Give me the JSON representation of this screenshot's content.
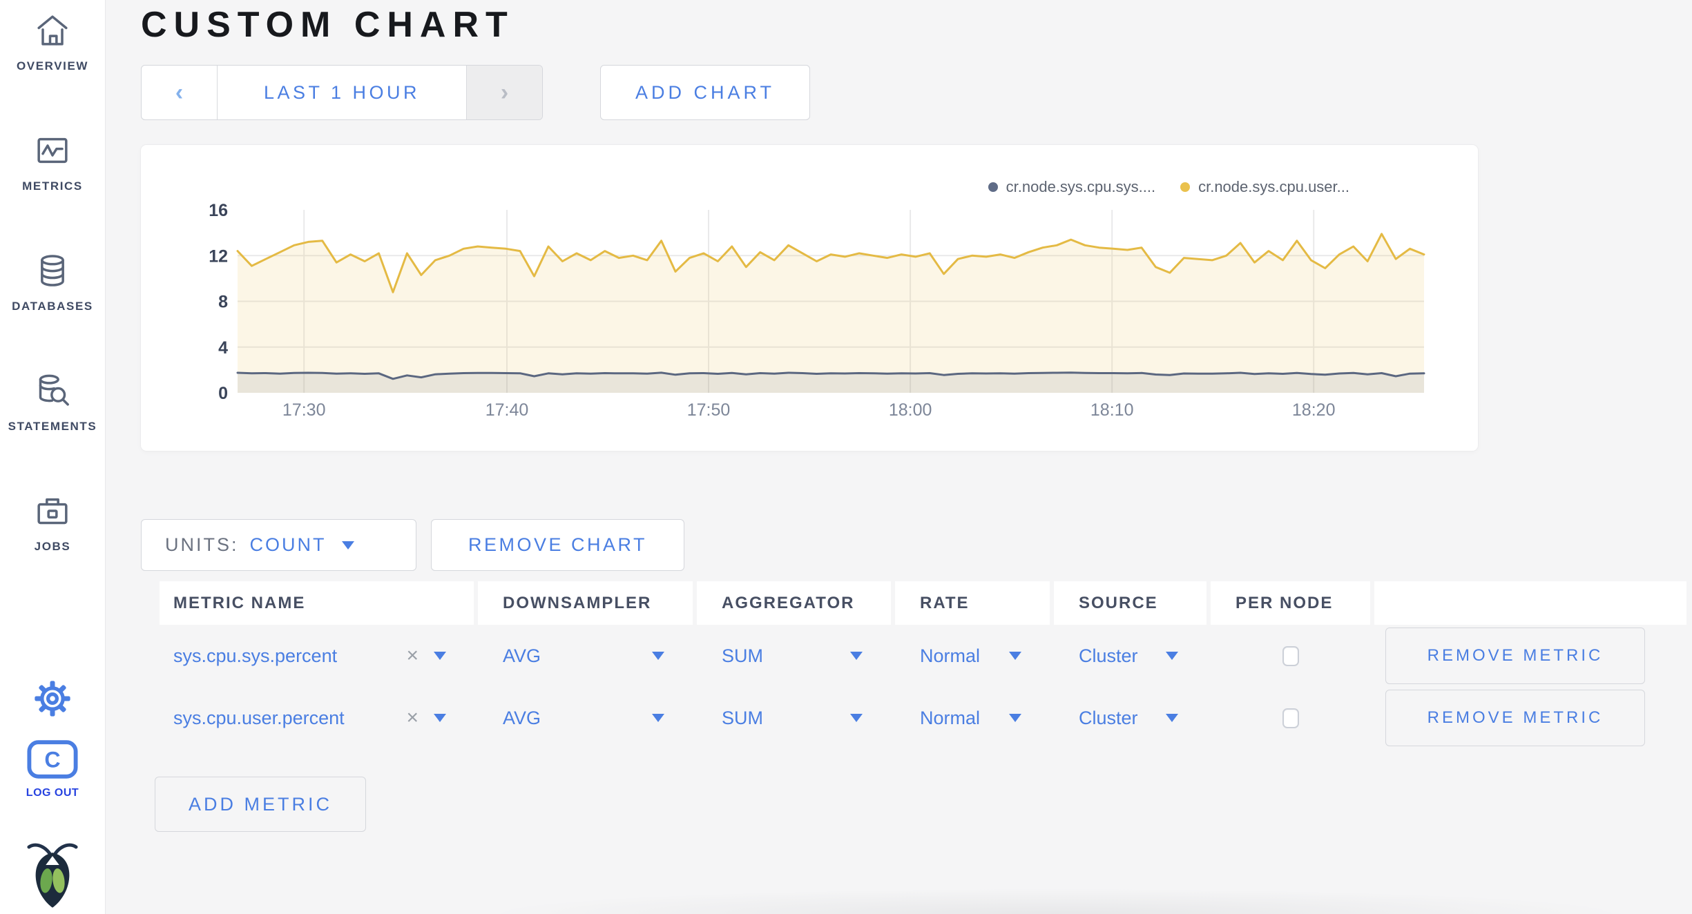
{
  "header": {
    "title": "CUSTOM CHART"
  },
  "sidebar": {
    "items": [
      {
        "label": "OVERVIEW",
        "icon": "home-icon"
      },
      {
        "label": "METRICS",
        "icon": "metrics-icon"
      },
      {
        "label": "DATABASES",
        "icon": "databases-icon"
      },
      {
        "label": "STATEMENTS",
        "icon": "statements-icon"
      },
      {
        "label": "JOBS",
        "icon": "jobs-icon"
      }
    ],
    "logout_label": "LOG OUT"
  },
  "toolbar": {
    "prev_icon": "‹",
    "next_icon": "›",
    "time_range_label": "LAST 1 HOUR",
    "add_chart_label": "ADD CHART"
  },
  "chart_controls": {
    "units_label": "UNITS:",
    "units_value": "COUNT",
    "remove_chart_label": "REMOVE CHART",
    "add_metric_label": "ADD METRIC"
  },
  "colors": {
    "accent_blue": "#4a7ee2",
    "series_sys_line": "#5b6780",
    "series_sys_dot": "#5f6c87",
    "series_user_line": "#e4ba44",
    "series_user_dot": "#eac14d",
    "gridline": "#e9e9ea",
    "y_tick_text": "#3a4459",
    "x_tick_text": "#7d8698"
  },
  "chart_data": {
    "type": "line",
    "title": "",
    "xlabel": "",
    "ylabel": "",
    "ylim": [
      0,
      16
    ],
    "yticks": [
      0,
      4,
      8,
      12,
      16
    ],
    "gridline_values": [
      4,
      8,
      12
    ],
    "grid": true,
    "legend_position": "top-right",
    "xticks": {
      "labels": [
        "17:30",
        "17:40",
        "17:50",
        "18:00",
        "18:10",
        "18:20"
      ],
      "fracs": [
        0.056,
        0.227,
        0.397,
        0.567,
        0.737,
        0.907
      ]
    },
    "legend": [
      {
        "name": "cr.node.sys.cpu.sys....",
        "color": "#5f6c87"
      },
      {
        "name": "cr.node.sys.cpu.user...",
        "color": "#eac14d"
      }
    ],
    "series": [
      {
        "name": "cr.node.sys.cpu.sys....",
        "color": "#5b6780",
        "fill": "rgba(95,108,135,0.12)",
        "values": [
          1.75,
          1.7,
          1.72,
          1.68,
          1.73,
          1.75,
          1.74,
          1.68,
          1.71,
          1.66,
          1.7,
          1.22,
          1.52,
          1.35,
          1.62,
          1.68,
          1.72,
          1.74,
          1.73,
          1.72,
          1.71,
          1.45,
          1.7,
          1.62,
          1.7,
          1.68,
          1.72,
          1.7,
          1.71,
          1.68,
          1.76,
          1.58,
          1.7,
          1.72,
          1.66,
          1.74,
          1.62,
          1.72,
          1.68,
          1.75,
          1.72,
          1.66,
          1.71,
          1.69,
          1.72,
          1.7,
          1.68,
          1.71,
          1.69,
          1.72,
          1.56,
          1.66,
          1.7,
          1.69,
          1.71,
          1.68,
          1.72,
          1.74,
          1.75,
          1.77,
          1.74,
          1.72,
          1.72,
          1.71,
          1.73,
          1.6,
          1.56,
          1.69,
          1.68,
          1.67,
          1.7,
          1.75,
          1.64,
          1.71,
          1.66,
          1.74,
          1.64,
          1.58,
          1.69,
          1.73,
          1.62,
          1.72,
          1.45,
          1.68,
          1.7
        ]
      },
      {
        "name": "cr.node.sys.cpu.user...",
        "color": "#e4ba44",
        "fill": "rgba(233,196,90,0.15)",
        "values": [
          12.4,
          11.1,
          11.7,
          12.3,
          12.9,
          13.2,
          13.3,
          11.4,
          12.1,
          11.5,
          12.2,
          8.8,
          12.2,
          10.3,
          11.6,
          12.0,
          12.6,
          12.8,
          12.7,
          12.6,
          12.4,
          10.2,
          12.8,
          11.5,
          12.2,
          11.6,
          12.4,
          11.8,
          12.0,
          11.6,
          13.3,
          10.6,
          11.8,
          12.2,
          11.5,
          12.8,
          11.0,
          12.3,
          11.6,
          12.9,
          12.2,
          11.5,
          12.1,
          11.9,
          12.2,
          12.0,
          11.8,
          12.1,
          11.9,
          12.2,
          10.4,
          11.7,
          12.0,
          11.9,
          12.1,
          11.8,
          12.3,
          12.7,
          12.9,
          13.4,
          12.9,
          12.7,
          12.6,
          12.5,
          12.7,
          11.0,
          10.5,
          11.8,
          11.7,
          11.6,
          12.0,
          13.1,
          11.4,
          12.4,
          11.6,
          13.3,
          11.6,
          10.9,
          12.1,
          12.8,
          11.5,
          13.9,
          11.7,
          12.6,
          12.1
        ]
      }
    ]
  },
  "table": {
    "columns": [
      "METRIC NAME",
      "DOWNSAMPLER",
      "AGGREGATOR",
      "RATE",
      "SOURCE",
      "PER NODE",
      ""
    ],
    "rows": [
      {
        "metric": "sys.cpu.sys.percent",
        "downsampler": "AVG",
        "aggregator": "SUM",
        "rate": "Normal",
        "source": "Cluster",
        "per_node_checked": false,
        "remove_label": "REMOVE METRIC"
      },
      {
        "metric": "sys.cpu.user.percent",
        "downsampler": "AVG",
        "aggregator": "SUM",
        "rate": "Normal",
        "source": "Cluster",
        "per_node_checked": false,
        "remove_label": "REMOVE METRIC"
      }
    ]
  }
}
